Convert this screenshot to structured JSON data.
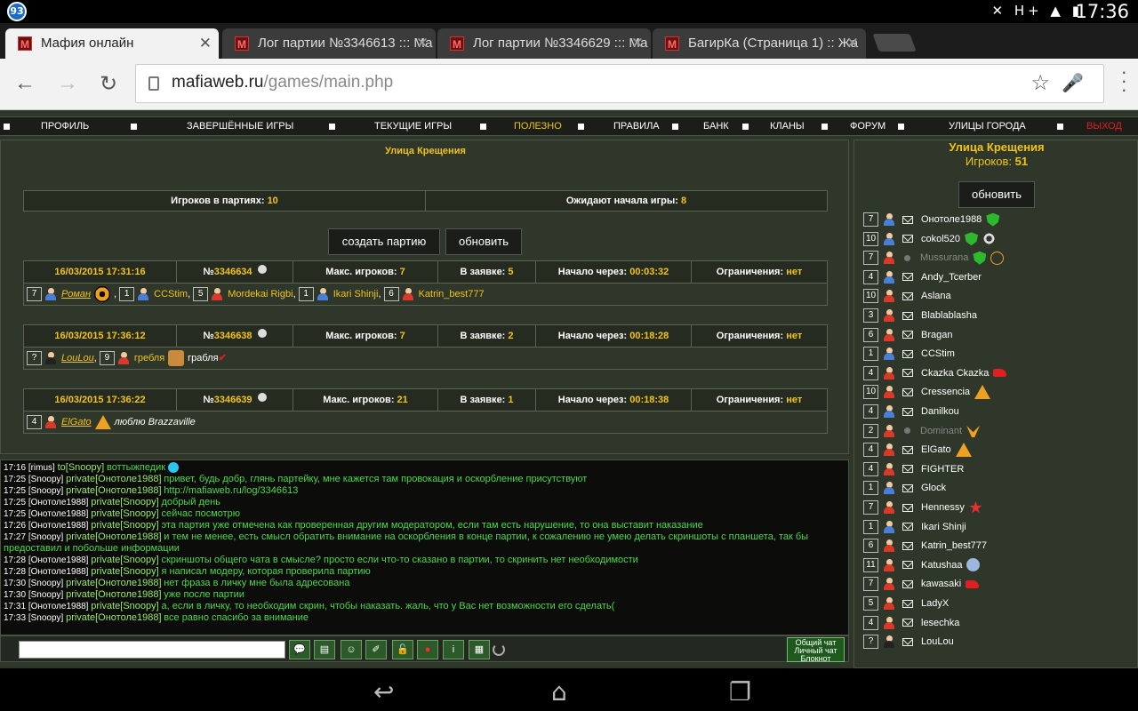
{
  "statusbar": {
    "notification_count": "93",
    "clock": "17:36",
    "icons": "✕ H+ ▲ ▮"
  },
  "tabs": [
    {
      "title": "Мафия онлайн"
    },
    {
      "title": "Лог партии №3346613 ::: Ма"
    },
    {
      "title": "Лог партии №3346629 ::: Ма"
    },
    {
      "title": "БагирКа (Страница 1) :: Жа"
    }
  ],
  "omnibox": {
    "host": "mafiaweb.ru",
    "path": "/games/main.php"
  },
  "topnav": [
    "ПРОФИЛЬ",
    "ЗАВЕРШЁННЫЕ ИГРЫ",
    "ТЕКУЩИЕ ИГРЫ",
    "ПОЛЕЗНО",
    "ПРАВИЛА",
    "БАНК",
    "КЛАНЫ",
    "ФОРУМ",
    "УЛИЦЫ ГОРОДА",
    "ВЫХОД"
  ],
  "main": {
    "street": "Улица Крещения",
    "players_in_games_label": "Игроков в партиях:",
    "players_in_games": "10",
    "waiting_label": "Ожидают начала игры:",
    "waiting": "8",
    "create_button": "создать партию",
    "refresh_button": "обновить"
  },
  "labels": {
    "max": "Макс. игроков:",
    "bid": "В заявке:",
    "start": "Начало через:",
    "limit": "Ограничения:",
    "no": "нет",
    "no_prefix": "№"
  },
  "games": [
    {
      "date": "16/03/2015 17:31:16",
      "id": "3346634",
      "max": "7",
      "bid": "5",
      "start": "00:03:32",
      "players": [
        {
          "n": "7",
          "name": "Роман",
          "host": true,
          "extra": "target",
          "c": "blue"
        },
        {
          "n": "1",
          "name": "CCStim",
          "c": "blue"
        },
        {
          "n": "5",
          "name": "Mordekai Rigbi",
          "c": "red"
        },
        {
          "n": "1",
          "name": "Ikari Shinji",
          "c": "blue"
        },
        {
          "n": "6",
          "name": "Katrin_best777",
          "c": "red"
        }
      ]
    },
    {
      "date": "16/03/2015 17:36:12",
      "id": "3346638",
      "max": "7",
      "bid": "2",
      "start": "00:18:28",
      "players": [
        {
          "n": "?",
          "name": "LouLou",
          "host": true,
          "c": "dark"
        },
        {
          "n": "9",
          "name": "гребля",
          "c": "red",
          "extra": "crown",
          "note": "грабля"
        }
      ]
    },
    {
      "date": "16/03/2015 17:36:22",
      "id": "3346639",
      "max": "21",
      "bid": "1",
      "start": "00:18:38",
      "players": [
        {
          "n": "4",
          "name": "ElGato",
          "host": true,
          "c": "red",
          "extra": "eye",
          "note": "люблю Brazzaville"
        }
      ]
    }
  ],
  "chat": [
    {
      "t": "17:16",
      "who": "[rimus]",
      "tag": "to[Snoopy]",
      "msg": "воттыжпедик",
      "smiley": true
    },
    {
      "t": "17:25",
      "who": "[Snoopy]",
      "tag": "private[Онотоле1988]",
      "msg": "привет, будь добр, глянь партейку, мне кажется там провокация и оскорбление присутствуют"
    },
    {
      "t": "17:25",
      "who": "[Snoopy]",
      "tag": "private[Онотоле1988]",
      "msg": "http://mafiaweb.ru/log/3346613"
    },
    {
      "t": "17:25",
      "who": "[Онотоле1988]",
      "tag": "private[Snoopy]",
      "msg": "добрый день"
    },
    {
      "t": "17:25",
      "who": "[Онотоле1988]",
      "tag": "private[Snoopy]",
      "msg": "сейчас посмотрю"
    },
    {
      "t": "17:26",
      "who": "[Онотоле1988]",
      "tag": "private[Snoopy]",
      "msg": "эта партия уже отмечена как проверенная другим модератором, если там есть нарушение, то она выставит наказание"
    },
    {
      "t": "17:27",
      "who": "[Snoopy]",
      "tag": "private[Онотоле1988]",
      "msg": "и тем не менее, есть смысл обратить внимание на оскорбления в конце партии, к сожалению не умею делать скриншоты с планшета, так бы предоставил и побольше информации"
    },
    {
      "t": "17:28",
      "who": "[Онотоле1988]",
      "tag": "private[Snoopy]",
      "msg": "скриншоты общего чата в смысле? просто если что-то сказано в партии, то скринить нет необходимости"
    },
    {
      "t": "17:28",
      "who": "[Онотоле1988]",
      "tag": "private[Snoopy]",
      "msg": "я написал модеру, которая проверила партию"
    },
    {
      "t": "17:30",
      "who": "[Snoopy]",
      "tag": "private[Онотоле1988]",
      "msg": "нет фраза в личку мне была адресована"
    },
    {
      "t": "17:30",
      "who": "[Snoopy]",
      "tag": "private[Онотоле1988]",
      "msg": "уже после партии"
    },
    {
      "t": "17:31",
      "who": "[Онотоле1988]",
      "tag": "private[Snoopy]",
      "msg": "а, если в личку, то необходим скрин, чтобы наказать. жаль, что у Вас нет возможности его сделать("
    },
    {
      "t": "17:33",
      "who": "[Snoopy]",
      "tag": "private[Онотоле1988]",
      "msg": "все равно спасибо за внимание"
    }
  ],
  "chat_tabs": [
    "Общий чат",
    "Личный чат",
    "Блокнот"
  ],
  "chat_buttons": [
    "💬",
    "▤",
    "☺",
    "✐",
    "🔓",
    "●",
    "i",
    "▦"
  ],
  "right": {
    "street": "Улица Крещения",
    "count_label": "Игроков:",
    "count": "51",
    "refresh": "обновить",
    "players": [
      {
        "n": "7",
        "name": "Онотоле1988",
        "c": "blue",
        "badges": [
          "shield"
        ]
      },
      {
        "n": "10",
        "name": "cokol520",
        "c": "blue",
        "badges": [
          "shield",
          "gear"
        ]
      },
      {
        "n": "7",
        "name": "Mussurana",
        "c": "red",
        "gray": true,
        "badges": [
          "shield",
          "scale"
        ]
      },
      {
        "n": "4",
        "name": "Andy_Tcerber",
        "c": "blue",
        "badges": []
      },
      {
        "n": "10",
        "name": "Aslana",
        "c": "red",
        "badges": []
      },
      {
        "n": "3",
        "name": "Blablablasha",
        "c": "red",
        "badges": []
      },
      {
        "n": "6",
        "name": "Bragan",
        "c": "red",
        "badges": []
      },
      {
        "n": "1",
        "name": "CCStim",
        "c": "blue",
        "badges": []
      },
      {
        "n": "4",
        "name": "Ckazka Ckazka",
        "c": "red",
        "badges": [
          "shoe"
        ]
      },
      {
        "n": "10",
        "name": "Cressencia",
        "c": "red",
        "badges": [
          "eye"
        ]
      },
      {
        "n": "4",
        "name": "Danilkou",
        "c": "blue",
        "badges": []
      },
      {
        "n": "2",
        "name": "Dominant",
        "c": "red",
        "gray": true,
        "badges": [
          "bird"
        ]
      },
      {
        "n": "4",
        "name": "ElGato",
        "c": "red",
        "badges": [
          "eye"
        ]
      },
      {
        "n": "4",
        "name": "FIGHTER",
        "c": "red",
        "badges": []
      },
      {
        "n": "1",
        "name": "Glock",
        "c": "blue",
        "badges": []
      },
      {
        "n": "7",
        "name": "Hennessy",
        "c": "red",
        "badges": [
          "star"
        ]
      },
      {
        "n": "1",
        "name": "Ikari Shinji",
        "c": "blue",
        "badges": []
      },
      {
        "n": "6",
        "name": "Katrin_best777",
        "c": "red",
        "badges": []
      },
      {
        "n": "11",
        "name": "Katushaa",
        "c": "red",
        "badges": [
          "wings"
        ]
      },
      {
        "n": "7",
        "name": "kawasaki",
        "c": "red",
        "badges": [
          "shoe"
        ]
      },
      {
        "n": "5",
        "name": "LadyX",
        "c": "red",
        "badges": []
      },
      {
        "n": "4",
        "name": "lesechka",
        "c": "red",
        "badges": []
      },
      {
        "n": "?",
        "name": "LouLou",
        "c": "dark",
        "badges": []
      }
    ]
  },
  "colors": {
    "accent": "#f0c419",
    "page_bg": "#2e3529",
    "chat_text": "#4cd84a",
    "logout": "#e02020"
  }
}
